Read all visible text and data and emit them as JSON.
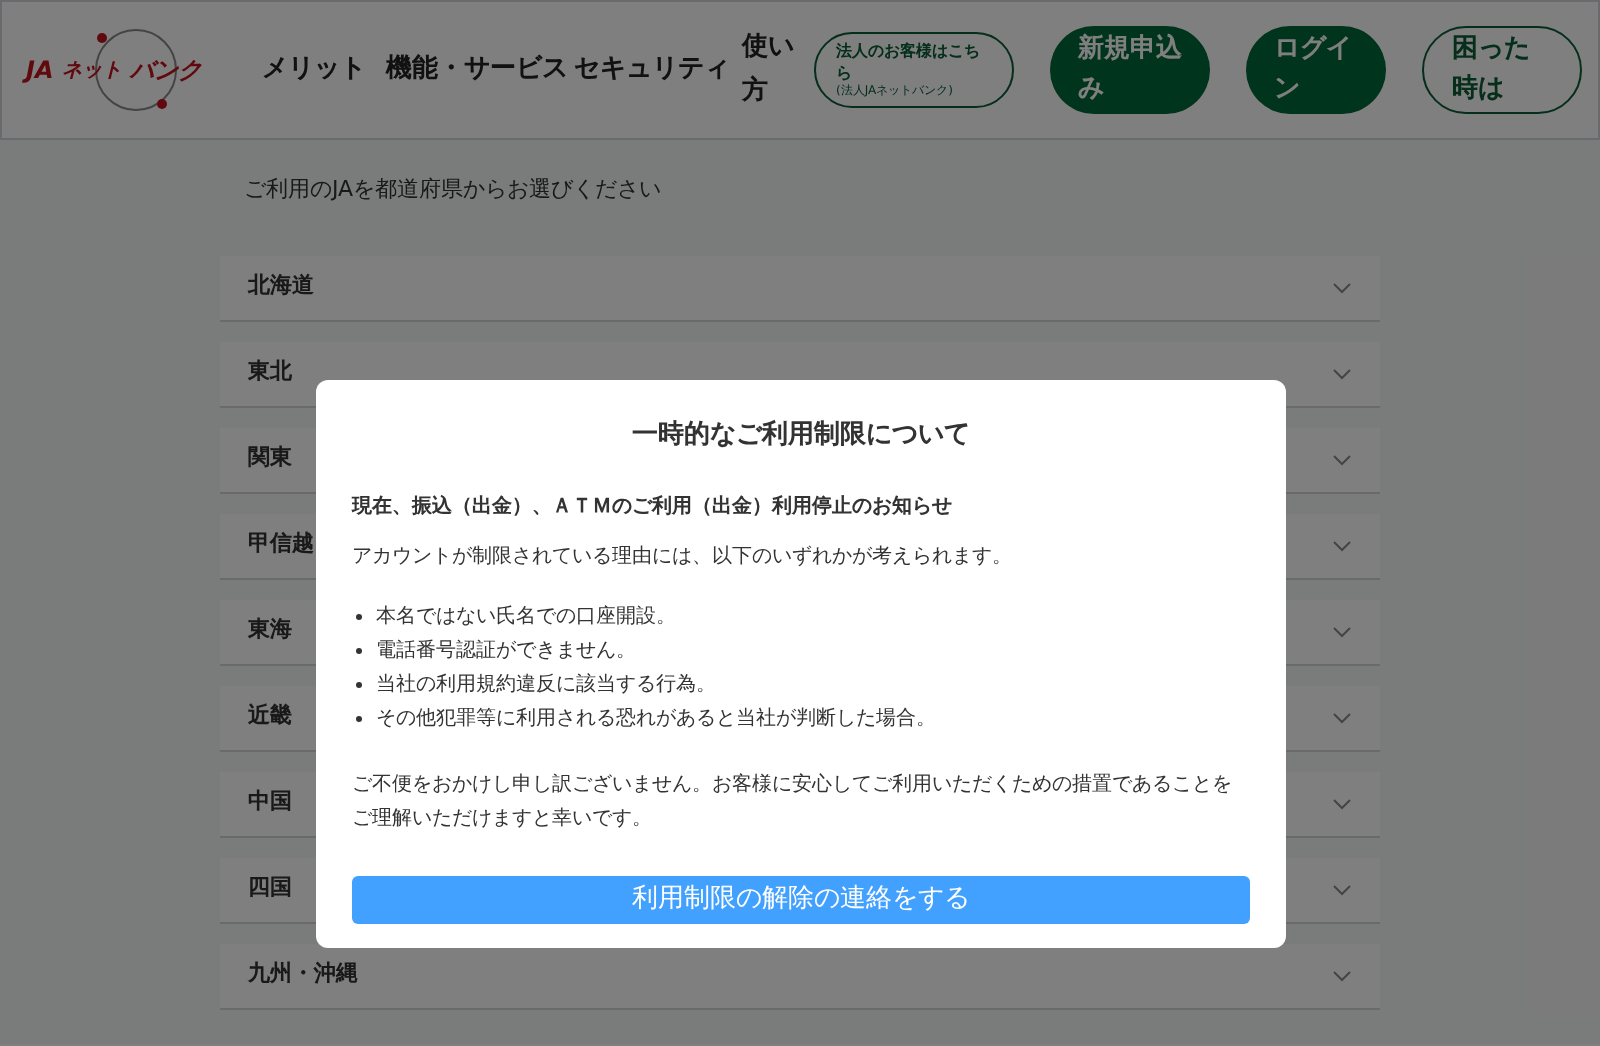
{
  "header": {
    "logo": {
      "parts": [
        "JA",
        "ネット",
        "バンク"
      ]
    },
    "nav": [
      "メリット",
      "機能・サービス",
      "セキュリティ",
      "使い方"
    ],
    "corporate_button": {
      "label": "法人のお客様はこちら",
      "sub": "(法人JAネットバンク)"
    },
    "buttons": [
      {
        "label": "新規申込み",
        "kind": "filled"
      },
      {
        "label": "ログイン",
        "kind": "filled"
      },
      {
        "label": "困った時は",
        "kind": "outline"
      }
    ]
  },
  "prompt": "ご利用のJAを都道府県からお選びください",
  "regions": [
    {
      "label": "北海道",
      "expanded": false
    },
    {
      "label": "東北",
      "expanded": false
    },
    {
      "label": "関東",
      "expanded": false
    },
    {
      "label": "甲信越",
      "expanded": false
    },
    {
      "label": "東海",
      "expanded": false
    },
    {
      "label": "近畿",
      "expanded": false
    },
    {
      "label": "中国",
      "expanded": false
    },
    {
      "label": "四国",
      "expanded": false
    },
    {
      "label": "九州・沖縄",
      "expanded": false
    }
  ],
  "modal": {
    "title": "一時的なご利用制限について",
    "subtitle": "現在、振込（出金）、ＡＴＭのご利用（出金）利用停止のお知らせ",
    "intro": "アカウントが制限されている理由には、以下のいずれかが考えられます。",
    "reasons": [
      "本名ではない氏名での口座開設。",
      "電話番号認証ができません。",
      "当社の利用規約違反に該当する行為。",
      "その他犯罪等に利用される恐れがあると当社が判断した場合。"
    ],
    "apology": "ご不便をおかけし申し訳ございません。お客様に安心してご利用いただくための措置であることをご理解いただけますと幸いです。",
    "action": "利用制限の解除の連絡をする"
  }
}
